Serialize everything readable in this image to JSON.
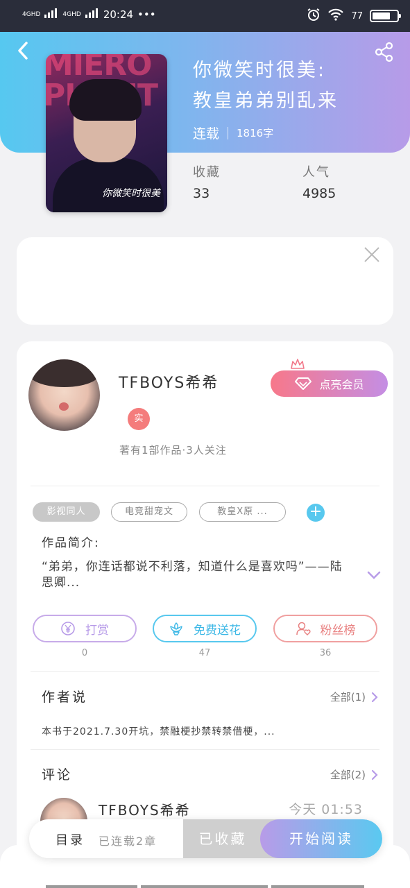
{
  "status_bar": {
    "signal1": "4GHD",
    "signal2": "4GHD",
    "time": "20:24",
    "dots": "•••",
    "battery": "77",
    "battery_level": 0.77
  },
  "book": {
    "title_line1": "你微笑时很美:",
    "title_line2": "教皇弟弟别乱来",
    "status": "连载",
    "word_count": "1816字",
    "favorites_label": "收藏",
    "favorites_value": "33",
    "popularity_label": "人气",
    "popularity_value": "4985",
    "cover_text": "MIERO PHANT",
    "cover_sign": "你微笑时很美"
  },
  "author": {
    "name": "TFBOYS希希",
    "badge": "实",
    "stats": "著有1部作品·3人关注",
    "vip_label": "点亮会员"
  },
  "tags": [
    "影视同人",
    "电竞甜宠文",
    "教皇X原 ..."
  ],
  "intro": {
    "label": "作品简介:",
    "text": "“弟弟，你连话都说不利落，知道什么是喜欢吗”——陆思卿..."
  },
  "actions": [
    {
      "label": "打赏",
      "count": "0",
      "color": "#b79be8"
    },
    {
      "label": "免费送花",
      "count": "47",
      "color": "#58c8ee"
    },
    {
      "label": "粉丝榜",
      "count": "36",
      "color": "#f08a8a"
    }
  ],
  "author_says": {
    "title": "作者说",
    "more": "全部(1)",
    "text": "本书于2021.7.30开坑，禁融梗抄禁转禁借梗，..."
  },
  "comments": {
    "title": "评论",
    "more": "全部(2)",
    "first_name": "TFBOYS希希",
    "first_time": "今天 01:53"
  },
  "bottom_bar": {
    "toc": "目录",
    "toc_sub": "已连载2章",
    "collected": "已收藏",
    "read": "开始阅读"
  }
}
